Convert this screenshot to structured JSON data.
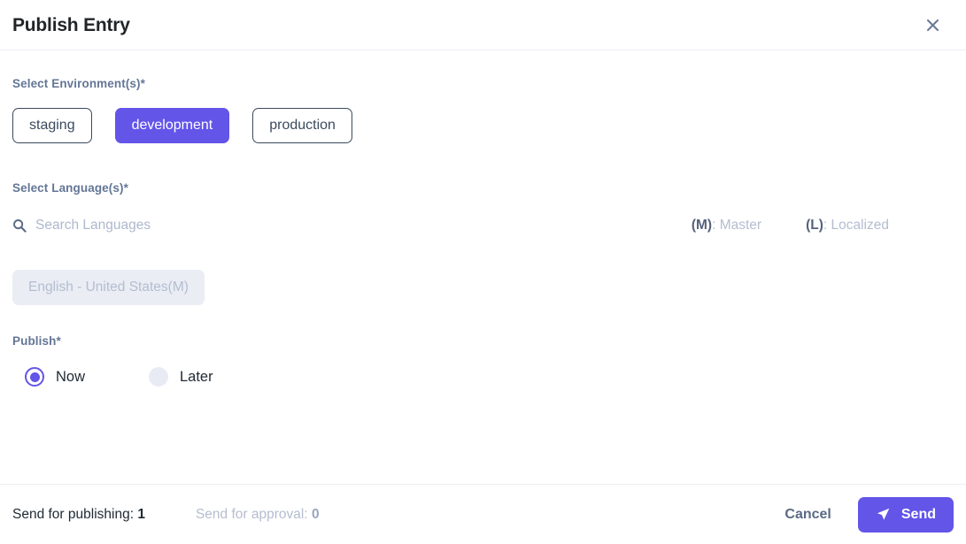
{
  "modal": {
    "title": "Publish Entry",
    "close_icon": "close-icon"
  },
  "environment": {
    "label": "Select Environment(s)*",
    "options": [
      {
        "label": "staging",
        "selected": false
      },
      {
        "label": "development",
        "selected": true
      },
      {
        "label": "production",
        "selected": false
      }
    ]
  },
  "languages": {
    "label": "Select Language(s)*",
    "search": {
      "icon": "search-icon",
      "value": "",
      "placeholder": "Search Languages"
    },
    "legend": [
      {
        "key": "(M)",
        "text": ": Master"
      },
      {
        "key": "(L)",
        "text": ": Localized"
      }
    ],
    "selected": [
      {
        "label": "English - United States(M)",
        "disabled": true
      }
    ]
  },
  "publish": {
    "label": "Publish*",
    "options": [
      {
        "label": "Now",
        "checked": true
      },
      {
        "label": "Later",
        "checked": false
      }
    ]
  },
  "footer": {
    "publishing_label": "Send for publishing:",
    "publishing_count": "1",
    "approval_label": "Send for approval:",
    "approval_count": "0",
    "cancel_label": "Cancel",
    "send_label": "Send",
    "send_icon": "send-icon"
  },
  "colors": {
    "accent": "#6355e8",
    "label": "#647696",
    "muted": "#b4bdd0",
    "chip_border": "#3b4a5e",
    "disabled_chip_bg": "#eaedf4",
    "divider": "#eceef3"
  }
}
